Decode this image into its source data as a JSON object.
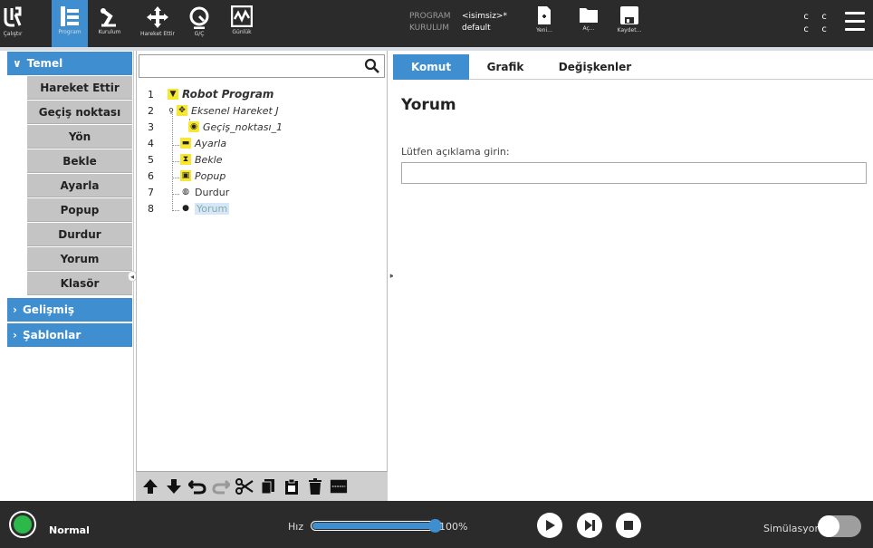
{
  "topbar": {
    "nav": [
      {
        "label": "Çalıştır"
      },
      {
        "label": "Program"
      },
      {
        "label": "Kurulum"
      },
      {
        "label": "Hareket Ettir"
      },
      {
        "label": "G/Ç"
      },
      {
        "label": "Günlük"
      }
    ],
    "program_key": "PROGRAM",
    "program_value": "<isimsiz>*",
    "installation_key": "KURULUM",
    "installation_value": "default",
    "file_actions": [
      {
        "label": "Yeni..."
      },
      {
        "label": "Aç..."
      },
      {
        "label": "Kaydet..."
      }
    ],
    "cc_top": "c c",
    "cc_bottom": "c c"
  },
  "palette": {
    "basic_header": "Temel",
    "items": [
      "Hareket Ettir",
      "Geçiş noktası",
      "Yön",
      "Bekle",
      "Ayarla",
      "Popup",
      "Durdur",
      "Yorum",
      "Klasör"
    ],
    "advanced_header": "Gelişmiş",
    "templates_header": "Şablonlar"
  },
  "tree": {
    "search_value": "",
    "rows": [
      {
        "num": "1",
        "text": "Robot Program"
      },
      {
        "num": "2",
        "text": "Eksenel Hareket J"
      },
      {
        "num": "3",
        "text": "Geçiş_noktası_1"
      },
      {
        "num": "4",
        "text": "Ayarla"
      },
      {
        "num": "5",
        "text": "Bekle"
      },
      {
        "num": "6",
        "text": "Popup"
      },
      {
        "num": "7",
        "text": "Durdur"
      },
      {
        "num": "8",
        "text": "Yorum"
      }
    ]
  },
  "right": {
    "tabs": [
      "Komut",
      "Grafik",
      "Değişkenler"
    ],
    "title": "Yorum",
    "label": "Lütfen açıklama girin:",
    "input_value": ""
  },
  "bottom": {
    "status": "Normal",
    "speed_label": "Hız",
    "speed_value": "100%",
    "speed_fraction": 1.0,
    "simulation_label": "Simülasyon"
  },
  "colors": {
    "accent": "#3e8ed0",
    "dark_bar": "#2b2b2b",
    "status_green": "#2db84a",
    "palette_item": "#c4c4c4",
    "node_yellow": "#f7e731"
  }
}
